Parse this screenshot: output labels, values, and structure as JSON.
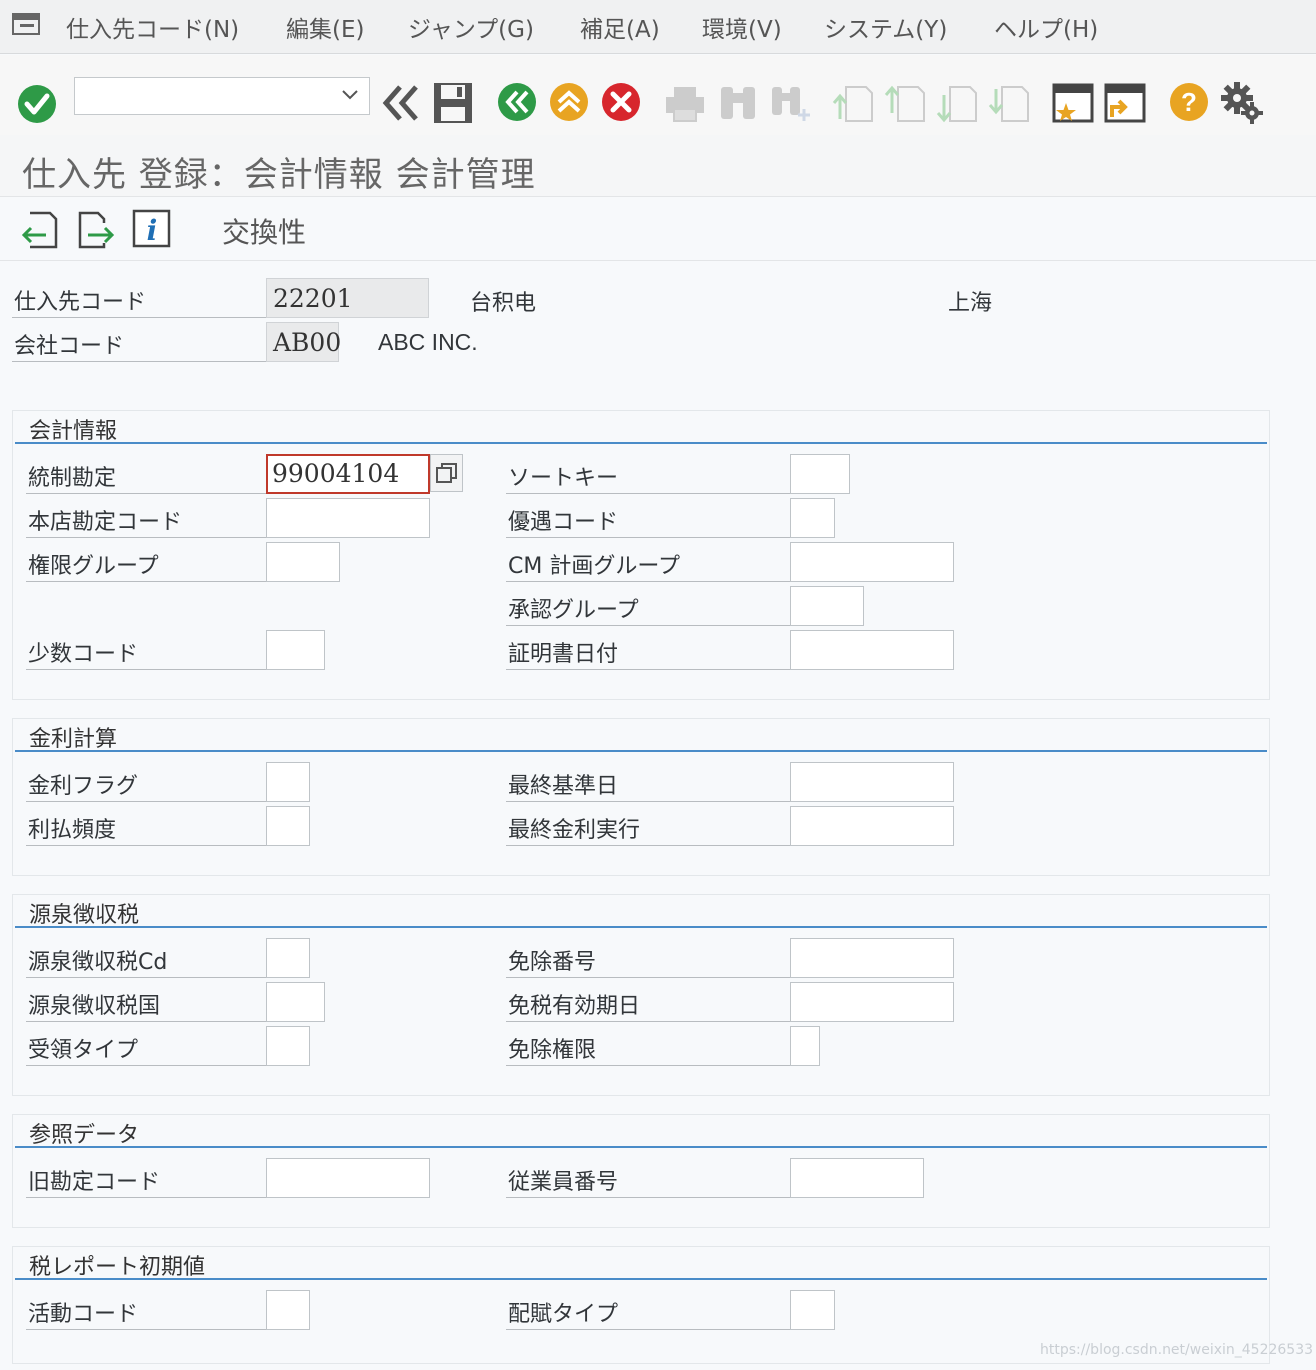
{
  "menu": {
    "items": [
      "仕入先コード(N)",
      "編集(E)",
      "ジャンプ(G)",
      "補足(A)",
      "環境(V)",
      "システム(Y)",
      "ヘルプ(H)"
    ]
  },
  "toolbar": {
    "command_field": ""
  },
  "title": "仕入先 登録：会計情報 会計管理",
  "app_toolbar": {
    "exchange_label": "交換性"
  },
  "header": {
    "vendor_label": "仕入先コード",
    "vendor_value": "22201",
    "vendor_name": "台积电",
    "vendor_city": "上海",
    "company_label": "会社コード",
    "company_value": "AB00",
    "company_name": "ABC INC."
  },
  "groups": {
    "accounting": {
      "title": "会計情報",
      "recon_label": "統制勘定",
      "recon_value": "99004104",
      "head_office_label": "本店勘定コード",
      "auth_group_label": "権限グループ",
      "minority_label": "少数コード",
      "sort_key_label": "ソートキー",
      "preference_label": "優遇コード",
      "cm_group_label": "CM 計画グループ",
      "approval_label": "承認グループ",
      "cert_date_label": "証明書日付"
    },
    "interest": {
      "title": "金利計算",
      "flag_label": "金利フラグ",
      "freq_label": "利払頻度",
      "last_key_label": "最終基準日",
      "last_run_label": "最終金利実行"
    },
    "withholding": {
      "title": "源泉徴収税",
      "code_label": "源泉徴収税Cd",
      "country_label": "源泉徴収税国",
      "recipient_label": "受領タイプ",
      "exemption_label": "免除番号",
      "valid_label": "免税有効期日",
      "authority_label": "免除権限"
    },
    "reference": {
      "title": "参照データ",
      "prev_acct_label": "旧勘定コード",
      "personnel_label": "従業員番号"
    },
    "tax_report": {
      "title": "税レポート初期値",
      "activity_label": "活動コード",
      "distribution_label": "配賦タイプ"
    }
  },
  "watermark": "https://blog.csdn.net/weixin_45226533",
  "colors": {
    "accent": "#4a8cc8",
    "green": "#2e9a47",
    "orange": "#e8a422",
    "red": "#d7262d",
    "focus": "#c0392b"
  }
}
